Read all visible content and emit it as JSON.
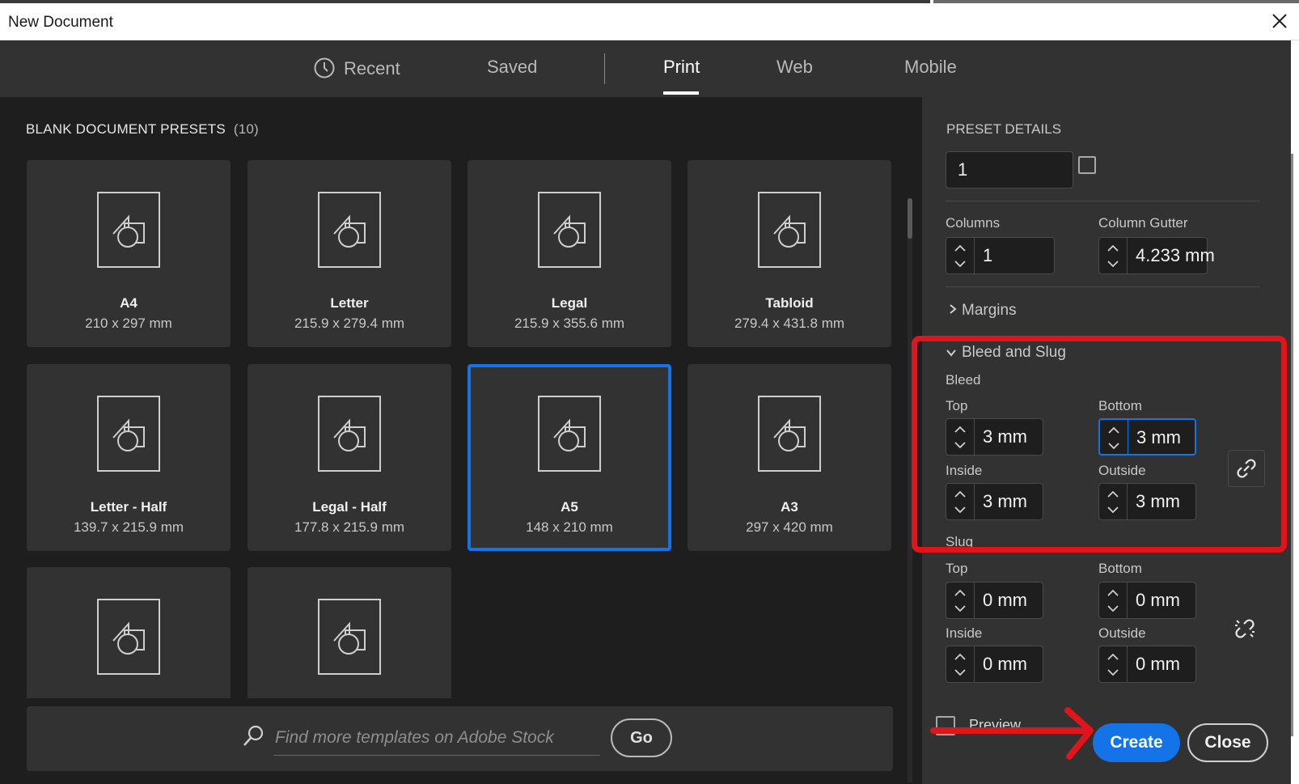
{
  "window": {
    "title": "New Document"
  },
  "tabs": [
    {
      "label": "Recent",
      "icon": "clock-icon"
    },
    {
      "label": "Saved"
    },
    {
      "label": "Print",
      "active": true
    },
    {
      "label": "Web"
    },
    {
      "label": "Mobile"
    }
  ],
  "presets": {
    "heading": "BLANK DOCUMENT PRESETS",
    "count": "(10)",
    "items": [
      {
        "name": "A4",
        "size": "210 x 297 mm"
      },
      {
        "name": "Letter",
        "size": "215.9 x 279.4 mm"
      },
      {
        "name": "Legal",
        "size": "215.9 x 355.6 mm"
      },
      {
        "name": "Tabloid",
        "size": "279.4 x 431.8 mm"
      },
      {
        "name": "Letter - Half",
        "size": "139.7 x 215.9 mm"
      },
      {
        "name": "Legal - Half",
        "size": "177.8 x 215.9 mm"
      },
      {
        "name": "A5",
        "size": "148 x 210 mm",
        "selected": true
      },
      {
        "name": "A3",
        "size": "297 x 420 mm"
      },
      {
        "name": "",
        "size": ""
      },
      {
        "name": "",
        "size": ""
      }
    ]
  },
  "search": {
    "placeholder": "Find more templates on Adobe Stock",
    "go_label": "Go"
  },
  "details": {
    "heading": "PRESET DETAILS",
    "pages_value": "1",
    "columns": {
      "label": "Columns",
      "value": "1"
    },
    "gutter": {
      "label": "Column Gutter",
      "value": "4.233 mm"
    },
    "margins_label": "Margins",
    "bleed_slug_label": "Bleed and Slug",
    "bleed": {
      "label": "Bleed",
      "top_label": "Top",
      "top": "3 mm",
      "bottom_label": "Bottom",
      "bottom": "3 mm",
      "inside_label": "Inside",
      "inside": "3 mm",
      "outside_label": "Outside",
      "outside": "3 mm"
    },
    "slug": {
      "label": "Slug",
      "top_label": "Top",
      "top": "0 mm",
      "bottom_label": "Bottom",
      "bottom": "0 mm",
      "inside_label": "Inside",
      "inside": "0 mm",
      "outside_label": "Outside",
      "outside": "0 mm"
    }
  },
  "footer": {
    "preview_label": "Preview",
    "create_label": "Create",
    "close_label": "Close"
  },
  "colors": {
    "accent": "#1473e6",
    "annotation": "#e0141b"
  }
}
